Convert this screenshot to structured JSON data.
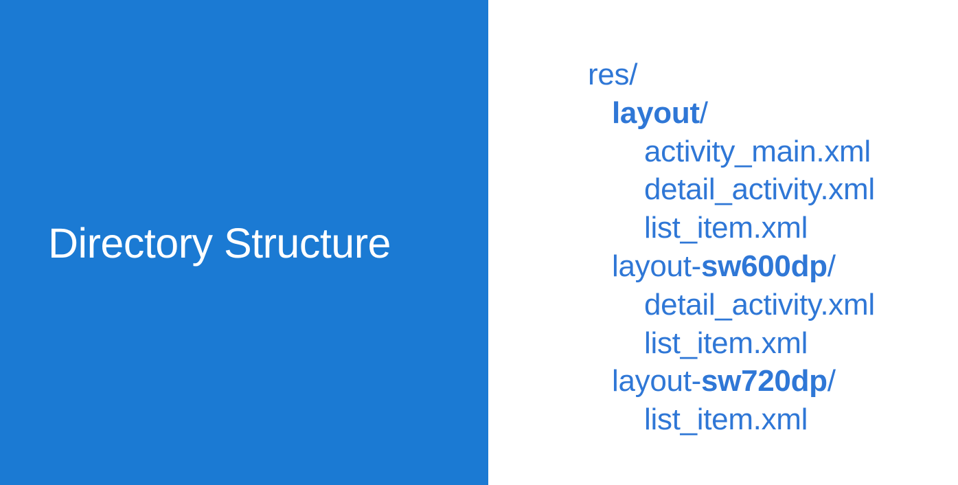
{
  "slide": {
    "title": "Directory Structure",
    "colors": {
      "left_panel_background": "#1b7ad3",
      "title_text": "#ffffff",
      "tree_text": "#2f77d6",
      "right_panel_background": "#ffffff"
    }
  },
  "tree": {
    "res": "res/",
    "layout": {
      "name": "layout",
      "slash": "/",
      "files": [
        "activity_main.xml",
        "detail_activity.xml",
        "list_item.xml"
      ]
    },
    "layout_sw600dp": {
      "prefix": "layout-",
      "qualifier": "sw600dp",
      "slash": "/",
      "files": [
        "detail_activity.xml",
        "list_item.xml"
      ]
    },
    "layout_sw720dp": {
      "prefix": "layout-",
      "qualifier": "sw720dp",
      "slash": "/",
      "files": [
        "list_item.xml"
      ]
    }
  }
}
